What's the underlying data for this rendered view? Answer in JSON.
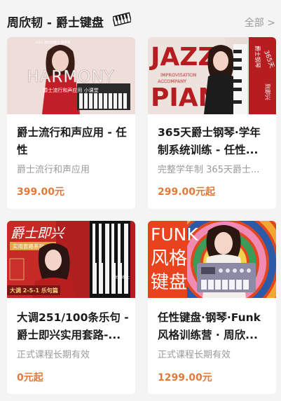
{
  "header": {
    "title": "周欣韧 - 爵士键盘",
    "more_label": "全部 >"
  },
  "courses": [
    {
      "title": "爵士流行和声应用 - 任性",
      "subtitle": "爵士流行和声应用",
      "price": "399.00元",
      "cover_text": [
        "HARMONY",
        "爵士流行和声应用 小课堂",
        "2021 周欣韧爵士 钢琴课"
      ]
    },
    {
      "title": "365天爵士钢琴·学年制系统训练 - 任性...",
      "subtitle": "完整学年制  365天爵士...",
      "price": "299.00元起",
      "cover_text": [
        "JAZZ",
        "PIAN",
        "IMPROVISATION",
        "ACCOMPANY",
        "爵士钢琴",
        "365天",
        "到即兴"
      ]
    },
    {
      "title": "大调251/100条乐句 - 爵士即兴实用套路-...",
      "subtitle": "正式课程长期有效",
      "price": "0元起",
      "cover_text": [
        "爵士即兴",
        "实用套路系列",
        "大调 2-5-1 乐句篇",
        "周欣韧爵士"
      ]
    },
    {
      "title": "任性键盘·钢琴·Funk风格训练营 · 周欣...",
      "subtitle": "正式课程长期有效",
      "price": "1299.00元",
      "cover_text": [
        "FUNK",
        "风格",
        "键盘"
      ]
    }
  ],
  "colors": {
    "price": "#e07a3a",
    "accent_red": "#b51d20"
  }
}
